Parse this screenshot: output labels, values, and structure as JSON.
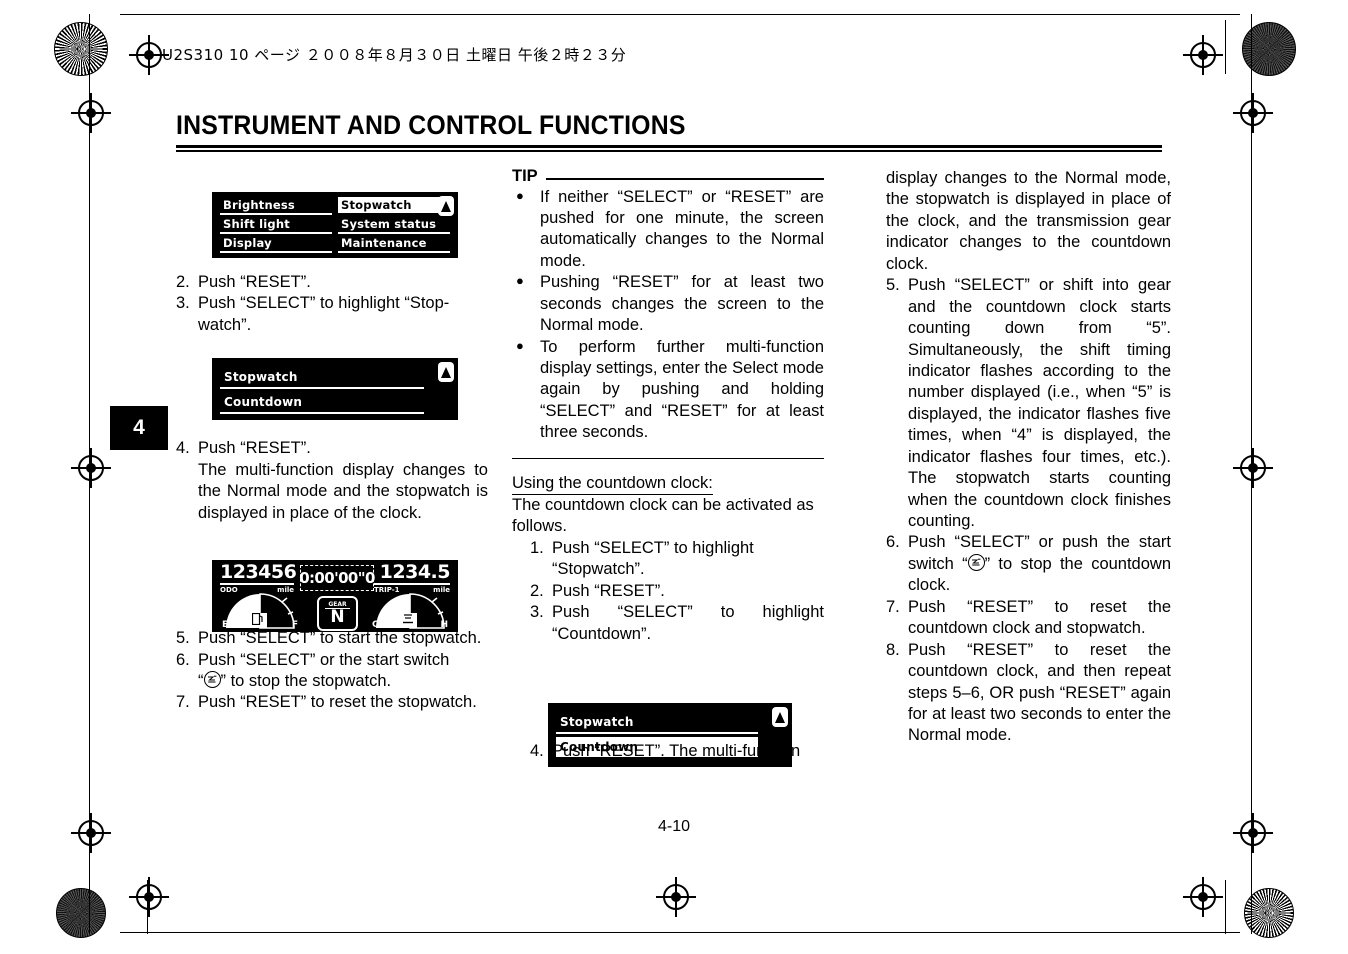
{
  "print_header": "U2S310  10 ページ  ２００８年８月３０日   土曜日   午後２時２３分",
  "chapter_tab": "4",
  "page_title": "INSTRUMENT AND CONTROL FUNCTIONS",
  "page_number": "4-10",
  "figures": {
    "menu_screen": {
      "items": [
        {
          "label": "Brightness",
          "highlighted": false
        },
        {
          "label": "Stopwatch",
          "highlighted": true
        },
        {
          "label": "Shift light",
          "highlighted": false
        },
        {
          "label": "System status",
          "highlighted": false
        },
        {
          "label": "Display",
          "highlighted": false
        },
        {
          "label": "Maintenance",
          "highlighted": false
        }
      ],
      "scroll_icon": "up-arrow-icon"
    },
    "stopwatch_menu": {
      "items": [
        {
          "label": "Stopwatch",
          "highlighted": false
        },
        {
          "label": "Countdown",
          "highlighted": false
        }
      ],
      "scroll_icon": "up-arrow-icon"
    },
    "countdown_menu": {
      "items": [
        {
          "label": "Stopwatch",
          "highlighted": false
        },
        {
          "label": "Countdown",
          "highlighted": true
        }
      ],
      "scroll_icon": "up-arrow-icon"
    },
    "meter_panel": {
      "odometer_value": "123456",
      "odometer_label": "ODO",
      "odometer_unit": "mile",
      "stopwatch_value": "0:00'00\"0",
      "trip_value": "1234.5",
      "trip_label": "TRIP-1",
      "trip_unit": "mile",
      "gear_label": "GEAR",
      "gear_value": "N",
      "fuel_min": "E",
      "fuel_max": "F",
      "temp_min": "C",
      "temp_max": "H"
    }
  },
  "column_left": {
    "steps": [
      {
        "n": "2.",
        "text": "Push “RESET”."
      },
      {
        "n": "3.",
        "text": "Push “SELECT” to highlight “Stop-watch”."
      },
      {
        "n": "4.",
        "text": "Push “RESET”."
      }
    ],
    "step4_detail": "The multi-function display changes to the Normal mode and the stopwatch is displayed in place of the clock.",
    "steps_after": [
      {
        "n": "5.",
        "text": "Push “SELECT” to start the stopwatch."
      },
      {
        "n": "6a.",
        "text": "Push “SELECT” or the start switch"
      },
      {
        "n": "6b.",
        "text": "” to stop the stopwatch."
      },
      {
        "n": "7.",
        "text": "Push “RESET” to reset the stopwatch."
      }
    ],
    "step6_quote_open": "“",
    "step6_icon": "start-switch-icon"
  },
  "column_middle": {
    "tip_label": "TIP",
    "tip_bullets": [
      "If neither “SELECT” or “RESET” are pushed for one minute, the screen automatically changes to the Normal mode.",
      "Pushing “RESET” for at least two seconds changes the screen to the Normal mode.",
      "To perform further multi-function display settings, enter the Select mode again by pushing and holding “SELECT” and “RESET” for at least three seconds."
    ],
    "section_heading": "Using the countdown clock:",
    "section_intro": "The countdown clock can be activated as follows.",
    "steps": [
      {
        "n": "1.",
        "text": "Push “SELECT” to highlight “Stopwatch”."
      },
      {
        "n": "2.",
        "text": "Push “RESET”."
      },
      {
        "n": "3.",
        "text": "Push “SELECT” to highlight “Countdown”."
      },
      {
        "n": "4.",
        "text": "Push “RESET”. The multi-function"
      }
    ]
  },
  "column_right": {
    "continuation": "display changes to the Normal mode, the stopwatch is displayed in place of the clock, and the transmission gear indicator changes to the countdown clock.",
    "steps": [
      {
        "n": "5.",
        "text": "Push “SELECT” or shift into gear and the countdown clock starts counting down from “5”. Simultaneously, the shift timing indicator flashes according to the number displayed (i.e., when “5” is displayed, the indicator flashes five times, when “4” is displayed, the indicator flashes four times, etc.). The stopwatch starts counting when the countdown clock finishes counting."
      },
      {
        "n": "6a.",
        "text": "Push “SELECT” or push the start switch “"
      },
      {
        "n": "6b.",
        "text": "” to stop the countdown clock."
      },
      {
        "n": "7.",
        "text": "Push “RESET” to reset the countdown clock and stopwatch."
      },
      {
        "n": "8.",
        "text": "Push “RESET” to reset the countdown clock, and then repeat steps 5–6, OR push “RESET” again for at least two seconds to enter the Normal mode."
      }
    ]
  }
}
